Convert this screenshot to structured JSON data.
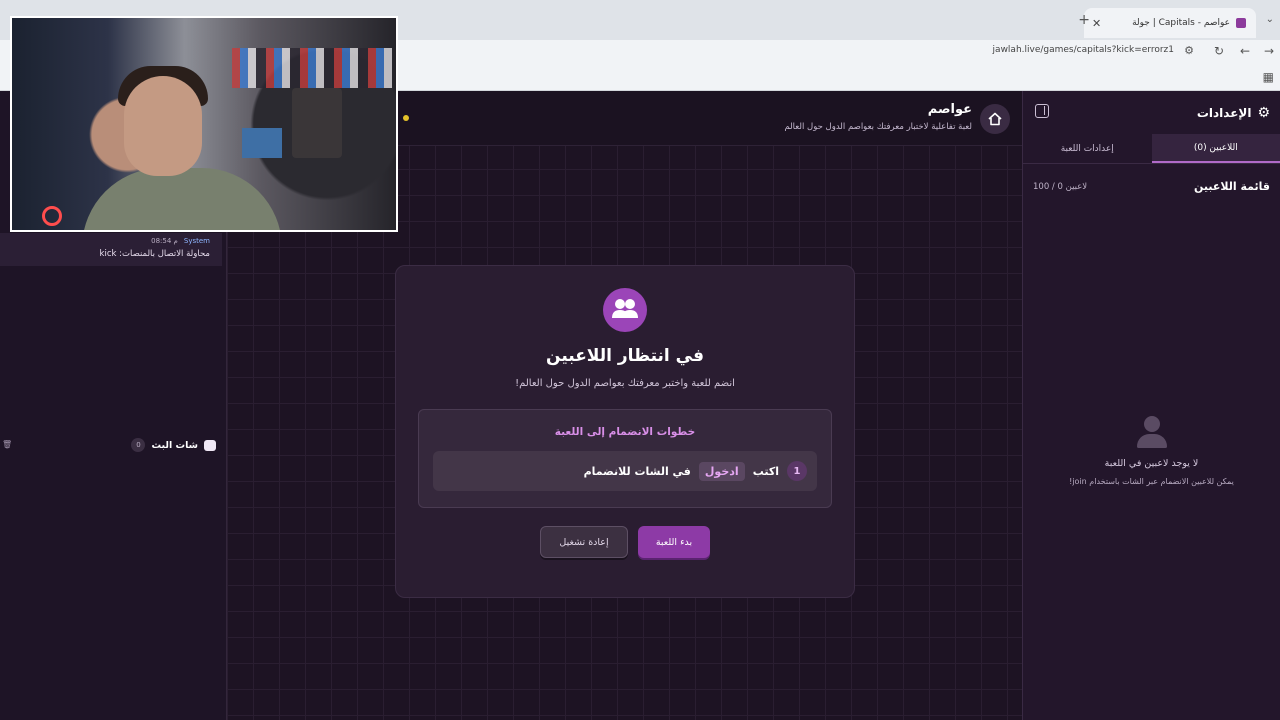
{
  "browser": {
    "tab_title": "عواصم - Capitals | جولة",
    "url": "jawlah.live/games/capitals?kick=errorz1"
  },
  "settings": {
    "title": "الإعدادات",
    "tabs": [
      {
        "label": "اللاعبين (0)",
        "active": true
      },
      {
        "label": "إعدادات اللعبة",
        "active": false
      }
    ],
    "players_title": "قائمة اللاعبين",
    "players_count": "100 / 0 لاعبين",
    "empty_title": "لا يوجد لاعبين في اللعبة",
    "empty_hint": "يمكن للاعبين الانضمام عبر الشات باستخدام join!"
  },
  "game": {
    "title": "عواصم",
    "subtitle": "لعبة تفاعلية لاختبار معرفتك بعواصم الدول حول العالم",
    "wait_title": "في انتظار اللاعبين",
    "wait_subtitle": "انضم للعبة واختبر معرفتك بعواصم الدول حول العالم!",
    "steps_title": "خطوات الانضمام إلى اللعبة",
    "step_number": "1",
    "step_prefix": "اكتب",
    "step_command": "ادخول",
    "step_suffix": "في الشات للانضمام",
    "start_button": "بدء اللعبة",
    "restart_button": "إعادة تشغيل"
  },
  "chat": {
    "message": {
      "sender": "System",
      "time": "08:54 م",
      "text": "محاولة الاتصال بالمنصات: kick"
    },
    "title": "شات البث",
    "count": "0"
  },
  "colors": {
    "accent": "#8d3aa6",
    "panel": "#23162b",
    "background": "#1b1221"
  }
}
